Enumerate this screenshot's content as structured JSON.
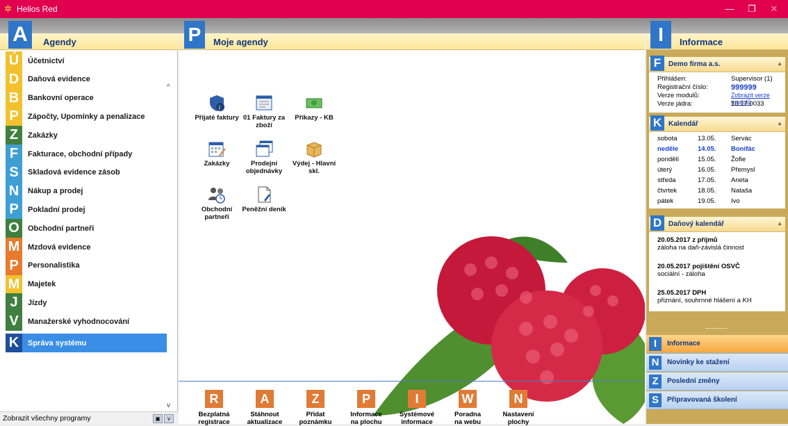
{
  "window": {
    "title": "Helios Red",
    "minimize": "—",
    "restore": "❐",
    "close": "✕"
  },
  "left": {
    "letter": "A",
    "title": "Agendy",
    "items": [
      {
        "letter": "Ú",
        "label": "Účetnictví",
        "color": "#f2c12e"
      },
      {
        "letter": "D",
        "label": "Daňová evidence",
        "color": "#f2c12e"
      },
      {
        "letter": "B",
        "label": "Bankovní operace",
        "color": "#f2c12e"
      },
      {
        "letter": "P",
        "label": "Zápočty, Upomínky a penalizace",
        "color": "#f2c12e"
      },
      {
        "letter": "Z",
        "label": "Zakázky",
        "color": "#3f7f3f"
      },
      {
        "letter": "F",
        "label": "Fakturace, obchodní případy",
        "color": "#3f9fd4"
      },
      {
        "letter": "S",
        "label": "Skladová evidence zásob",
        "color": "#3f9fd4"
      },
      {
        "letter": "N",
        "label": "Nákup a prodej",
        "color": "#3f9fd4"
      },
      {
        "letter": "P",
        "label": "Pokladní prodej",
        "color": "#3f9fd4"
      },
      {
        "letter": "O",
        "label": "Obchodní partneři",
        "color": "#3f7f3f"
      },
      {
        "letter": "M",
        "label": "Mzdová evidence",
        "color": "#e87a2e"
      },
      {
        "letter": "P",
        "label": "Personalistika",
        "color": "#e87a2e"
      },
      {
        "letter": "M",
        "label": "Majetek",
        "color": "#f2c12e"
      },
      {
        "letter": "J",
        "label": "Jízdy",
        "color": "#3f7f3f"
      },
      {
        "letter": "V",
        "label": "Manažerské vyhodnocování",
        "color": "#3f7f3f"
      }
    ],
    "active": {
      "letter": "K",
      "label": "Správa systému",
      "color": "#1f4f9a"
    },
    "footer": "Zobrazit všechny programy"
  },
  "middle": {
    "letter": "P",
    "title": "Moje agendy",
    "icons": [
      {
        "name": "Přijaté faktury",
        "icon": "shield-info-icon"
      },
      {
        "name": "01 Faktury za zboží",
        "icon": "invoice-window-icon"
      },
      {
        "name": "Příkazy - KB",
        "icon": "money-icon"
      },
      {
        "name": "Zakázky",
        "icon": "calendar-pen-icon"
      },
      {
        "name": "Prodejní objednávky",
        "icon": "windows-icon"
      },
      {
        "name": "Výdej - Hlavní skl.",
        "icon": "box-icon"
      },
      {
        "name": "Obchodní partneři",
        "icon": "people-clock-icon"
      },
      {
        "name": "Peněžní deník",
        "icon": "document-pen-icon"
      }
    ],
    "actions": [
      {
        "letter": "R",
        "line1": "Bezplatná",
        "line2": "registrace"
      },
      {
        "letter": "A",
        "line1": "Stáhnout",
        "line2": "aktualizace"
      },
      {
        "letter": "Z",
        "line1": "Přidat",
        "line2": "poznámku"
      },
      {
        "letter": "P",
        "line1": "Informace",
        "line2": "na plochu"
      },
      {
        "letter": "I",
        "line1": "Systémové",
        "line2": "informace"
      },
      {
        "letter": "W",
        "line1": "Poradna",
        "line2": "na webu"
      },
      {
        "letter": "N",
        "line1": "Nastavení",
        "line2": "plochy"
      }
    ]
  },
  "right": {
    "letter": "I",
    "title": "Informace",
    "firma": {
      "letter": "F",
      "title": "Demo firma a.s.",
      "rows": [
        {
          "k": "Přihlášen:",
          "v": "Supervisor  (1)"
        },
        {
          "k": "Registrační číslo:",
          "v": "999999"
        },
        {
          "k": "Verze modulů:",
          "v": "Zobrazit verze modulů"
        },
        {
          "k": "Verze jádra:",
          "v": "10.17.0033"
        }
      ]
    },
    "kalendar": {
      "letter": "K",
      "title": "Kalendář",
      "rows": [
        {
          "day": "sobota",
          "date": "13.05.",
          "name": "Servác"
        },
        {
          "day": "neděle",
          "date": "14.05.",
          "name": "Bonifác"
        },
        {
          "day": "pondělí",
          "date": "15.05.",
          "name": "Žofie"
        },
        {
          "day": "úterý",
          "date": "16.05.",
          "name": "Přemysl"
        },
        {
          "day": "středa",
          "date": "17.05.",
          "name": "Aneta"
        },
        {
          "day": "čtvrtek",
          "date": "18.05.",
          "name": "Nataša"
        },
        {
          "day": "pátek",
          "date": "19.05.",
          "name": "Ivo"
        }
      ]
    },
    "dane": {
      "letter": "D",
      "title": "Daňový kalendář",
      "items": [
        {
          "date": "20.05.2017",
          "title": "z příjmů",
          "desc": "záloha na daň-závislá činnost"
        },
        {
          "date": "20.05.2017",
          "title": "pojištění OSVČ",
          "desc": "sociální - záloha"
        },
        {
          "date": "25.05.2017",
          "title": "DPH",
          "desc": "přiznání, souhrnné hlášení a KH"
        }
      ]
    },
    "nav": [
      {
        "letter": "I",
        "label": "Informace"
      },
      {
        "letter": "N",
        "label": "Novinky ke stažení"
      },
      {
        "letter": "Z",
        "label": "Poslední změny"
      },
      {
        "letter": "S",
        "label": "Připravovaná školení"
      }
    ]
  }
}
